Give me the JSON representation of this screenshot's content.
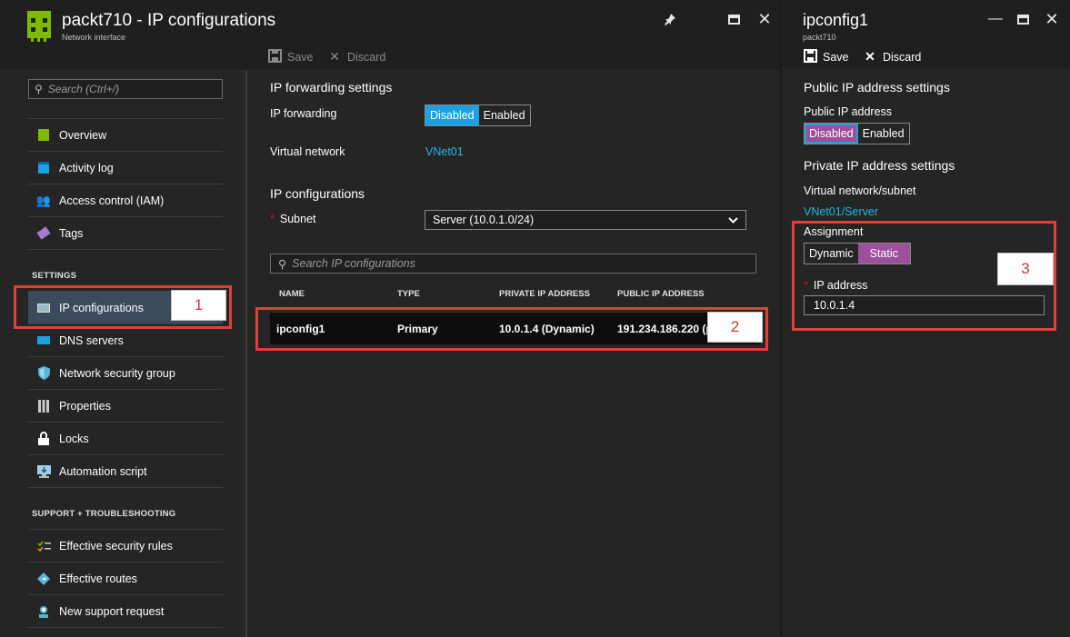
{
  "colors": {
    "accent_blue": "#1ba1e2",
    "link_blue": "#1fb7e8",
    "toggle_purple": "#9c4f9a",
    "annotation_red": "#e0403a",
    "resource_green": "#7fba00"
  },
  "left_blade": {
    "title": "packt710 - IP configurations",
    "subtitle": "Network interface",
    "commands": {
      "save": "Save",
      "discard": "Discard"
    },
    "search_placeholder": "Search (Ctrl+/)",
    "nav_top": [
      {
        "label": "Overview",
        "icon": "overview-icon"
      },
      {
        "label": "Activity log",
        "icon": "activity-log-icon"
      },
      {
        "label": "Access control (IAM)",
        "icon": "iam-icon"
      },
      {
        "label": "Tags",
        "icon": "tag-icon"
      }
    ],
    "settings_heading": "SETTINGS",
    "nav_settings": [
      {
        "label": "IP configurations",
        "icon": "ip-config-icon",
        "active": true
      },
      {
        "label": "DNS servers",
        "icon": "dns-icon"
      },
      {
        "label": "Network security group",
        "icon": "shield-icon"
      },
      {
        "label": "Properties",
        "icon": "properties-icon"
      },
      {
        "label": "Locks",
        "icon": "lock-icon"
      },
      {
        "label": "Automation script",
        "icon": "automation-icon"
      }
    ],
    "support_heading": "SUPPORT + TROUBLESHOOTING",
    "nav_support": [
      {
        "label": "Effective security rules",
        "icon": "security-rules-icon"
      },
      {
        "label": "Effective routes",
        "icon": "routes-icon"
      },
      {
        "label": "New support request",
        "icon": "support-icon"
      }
    ],
    "content": {
      "forwarding_heading": "IP forwarding settings",
      "forwarding_label": "IP forwarding",
      "forwarding_options": [
        "Disabled",
        "Enabled"
      ],
      "forwarding_selected": "Disabled",
      "vnet_label": "Virtual network",
      "vnet_value": "VNet01",
      "ipconfig_heading": "IP configurations",
      "subnet_label": "Subnet",
      "subnet_value": "Server (10.0.1.0/24)",
      "search_placeholder": "Search IP configurations",
      "table": {
        "headers": [
          "NAME",
          "TYPE",
          "PRIVATE IP ADDRESS",
          "PUBLIC IP ADDRESS"
        ],
        "rows": [
          [
            "ipconfig1",
            "Primary",
            "10.0.1.4 (Dynamic)",
            "191.234.186.220 (p"
          ]
        ]
      }
    }
  },
  "right_blade": {
    "title": "ipconfig1",
    "subtitle": "packt710",
    "commands": {
      "save": "Save",
      "discard": "Discard"
    },
    "public_heading": "Public IP address settings",
    "public_label": "Public IP address",
    "public_options": [
      "Disabled",
      "Enabled"
    ],
    "public_selected": "Disabled",
    "private_heading": "Private IP address settings",
    "vnet_subnet_label": "Virtual network/subnet",
    "vnet_subnet_value": "VNet01/Server",
    "assignment_label": "Assignment",
    "assignment_options": [
      "Dynamic",
      "Static"
    ],
    "assignment_selected": "Static",
    "ip_label": "IP address",
    "ip_value": "10.0.1.4"
  },
  "callouts": [
    "1",
    "2",
    "3"
  ]
}
